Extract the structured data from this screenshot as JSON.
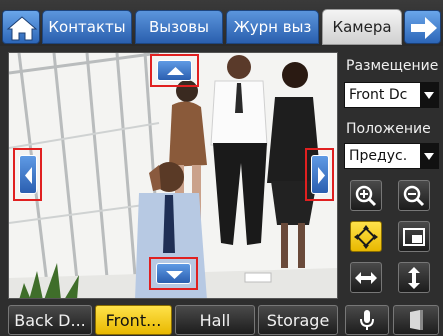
{
  "tabs": [
    {
      "label": "Контакты",
      "icon": "contacts"
    },
    {
      "label": "Вызовы",
      "icon": "calls"
    },
    {
      "label": "Журн выз",
      "icon": "call-log"
    },
    {
      "label": "Камера",
      "icon": "camera",
      "active": true
    }
  ],
  "camera_panel": {
    "placement_label": "Размещение",
    "placement_value": "Front Dc",
    "position_label": "Положение",
    "position_value": "Предус."
  },
  "presets": [
    {
      "label": "Back D...",
      "active": false
    },
    {
      "label": "Front...",
      "active": true
    },
    {
      "label": "Hall",
      "active": false
    },
    {
      "label": "Storage",
      "active": false
    }
  ],
  "colors": {
    "accent_blue": "#2c66b8",
    "active_yellow": "#f2c80f",
    "highlight_red": "#e02020"
  }
}
